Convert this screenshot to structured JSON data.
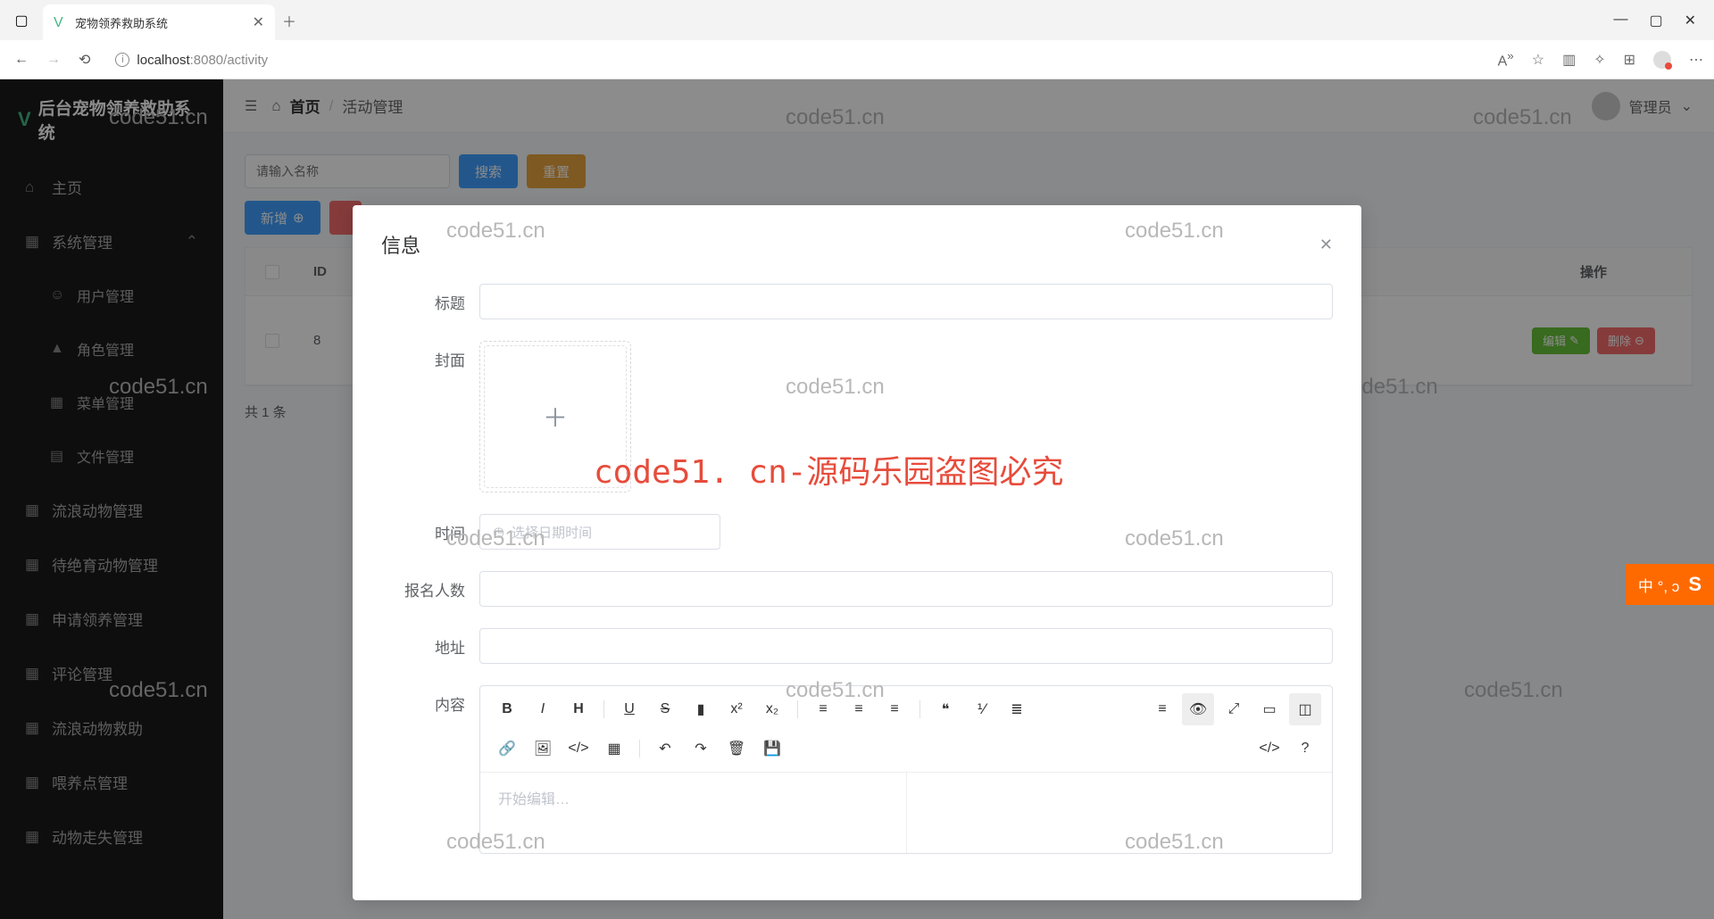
{
  "browser": {
    "tab_title": "宠物领养救助系统",
    "url_host": "localhost",
    "url_port_path": ":8080/activity"
  },
  "sidebar": {
    "title": "后台宠物领养救助系统",
    "home": "主页",
    "systemManage": "系统管理",
    "items": [
      "用户管理",
      "角色管理",
      "菜单管理",
      "文件管理",
      "流浪动物管理",
      "待绝育动物管理",
      "申请领养管理",
      "评论管理",
      "流浪动物救助",
      "喂养点管理",
      "动物走失管理"
    ]
  },
  "topbar": {
    "home": "首页",
    "current": "活动管理",
    "user": "管理员"
  },
  "toolbar": {
    "search_placeholder": "请输入名称",
    "search_btn": "搜索",
    "reset_btn": "重置",
    "add_btn": "新增",
    "del_btn": ""
  },
  "table": {
    "headers": {
      "id": "ID",
      "ops": "操作"
    },
    "row": {
      "id": "8",
      "edit": "编辑",
      "del": "删除"
    }
  },
  "pager": {
    "total": "共 1 条"
  },
  "modal": {
    "title": "信息",
    "fields": {
      "title": "标题",
      "cover": "封面",
      "time": "时间",
      "time_placeholder": "选择日期时间",
      "capacity": "报名人数",
      "address": "地址",
      "content": "内容"
    },
    "editor_placeholder": "开始编辑…"
  },
  "watermarks": {
    "text": "code51.cn",
    "center": "code51. cn-源码乐园盗图必究"
  },
  "ime": {
    "label": "中 °, ↄ"
  }
}
